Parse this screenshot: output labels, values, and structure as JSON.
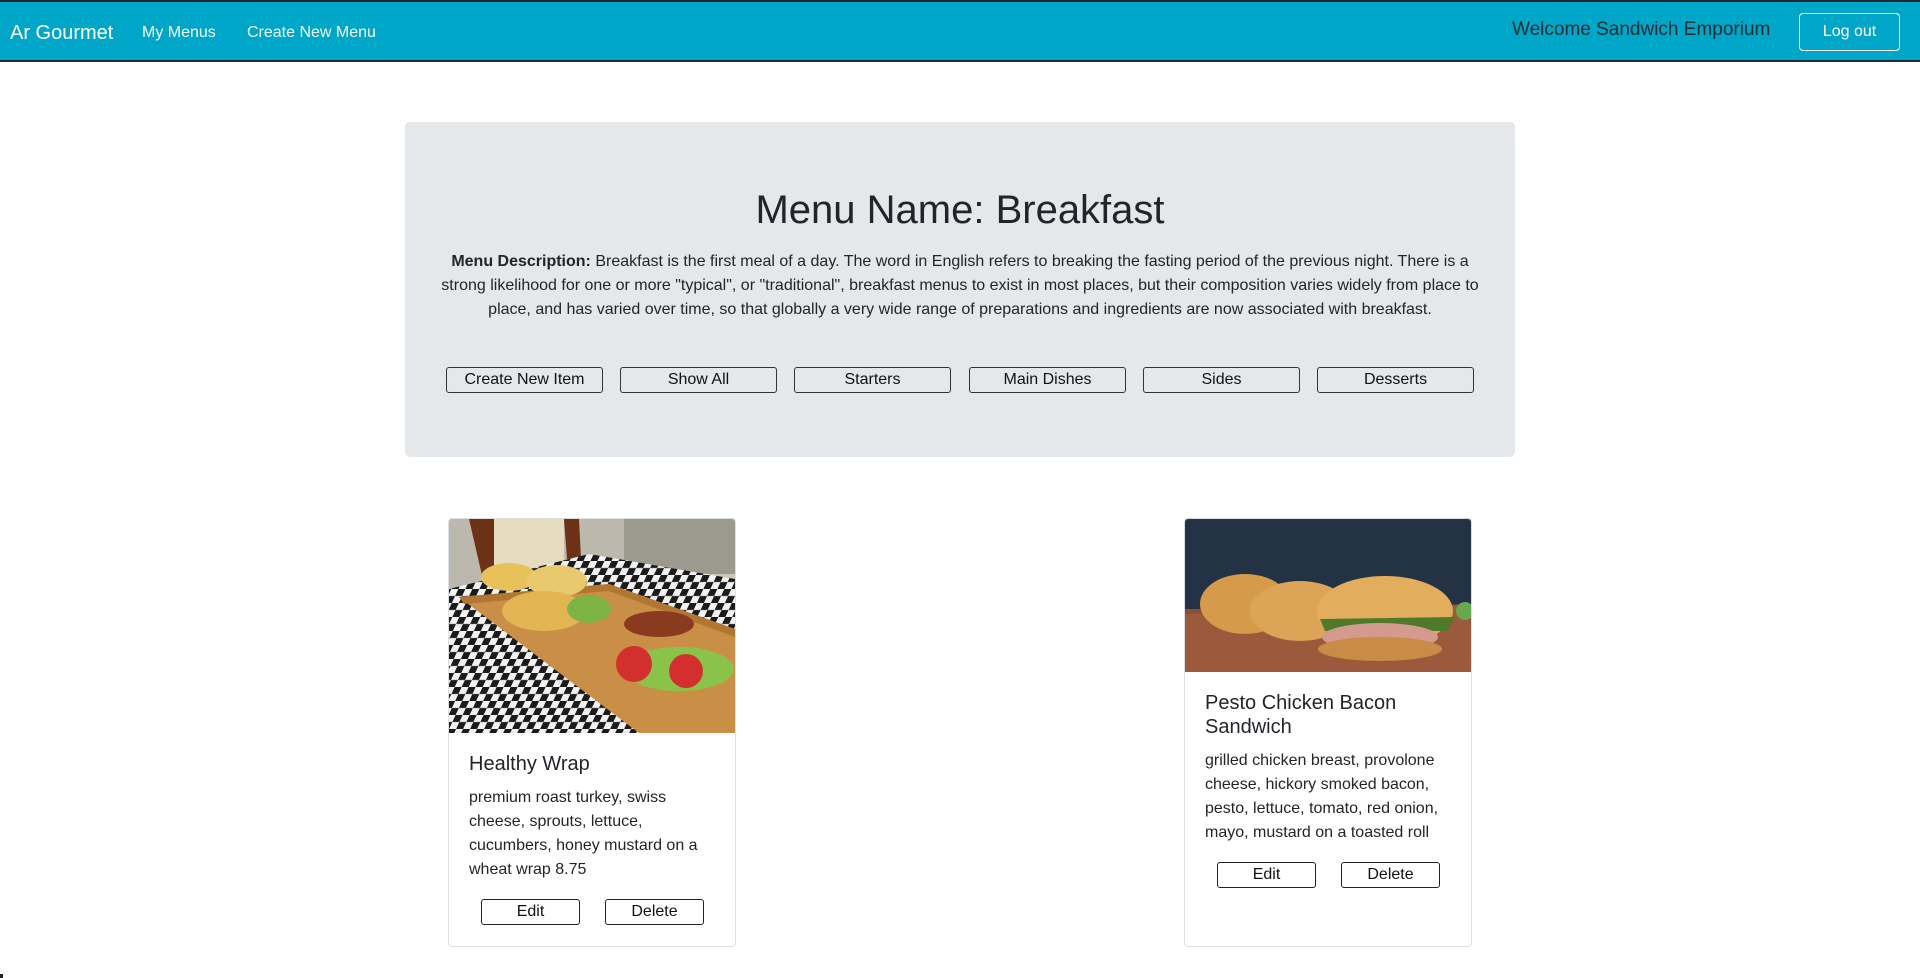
{
  "navbar": {
    "brand": "Ar Gourmet",
    "links": [
      "My Menus",
      "Create New Menu"
    ],
    "welcome": "Welcome Sandwich Emporium",
    "logout_label": "Log out",
    "colors": {
      "background": "#00a6c7",
      "text": "#ffffff"
    }
  },
  "menu": {
    "title": "Menu Name: Breakfast",
    "description_label": "Menu Description:",
    "description": "Breakfast is the first meal of a day. The word in English refers to breaking the fasting period of the previous night. There is a strong likelihood for one or more \"typical\", or \"traditional\", breakfast menus to exist in most places, but their composition varies widely from place to place, and has varied over time, so that globally a very wide range of preparations and ingredients are now associated with breakfast.",
    "actions": [
      "Create New Item",
      "Show All",
      "Starters",
      "Main Dishes",
      "Sides",
      "Desserts"
    ]
  },
  "items": [
    {
      "name": "Healthy Wrap",
      "description": "premium roast turkey, swiss cheese, sprouts, lettuce, cucumbers, honey mustard on a wheat wrap 8.75",
      "image": "wrap-platter-photo",
      "edit_label": "Edit",
      "delete_label": "Delete"
    },
    {
      "name": "Pesto Chicken Bacon Sandwich",
      "description": "grilled chicken breast, provolone cheese, hickory smoked bacon, pesto, lettuce, tomato, red onion, mayo, mustard on a toasted roll",
      "image": "croissant-sandwich-photo",
      "edit_label": "Edit",
      "delete_label": "Delete"
    }
  ]
}
